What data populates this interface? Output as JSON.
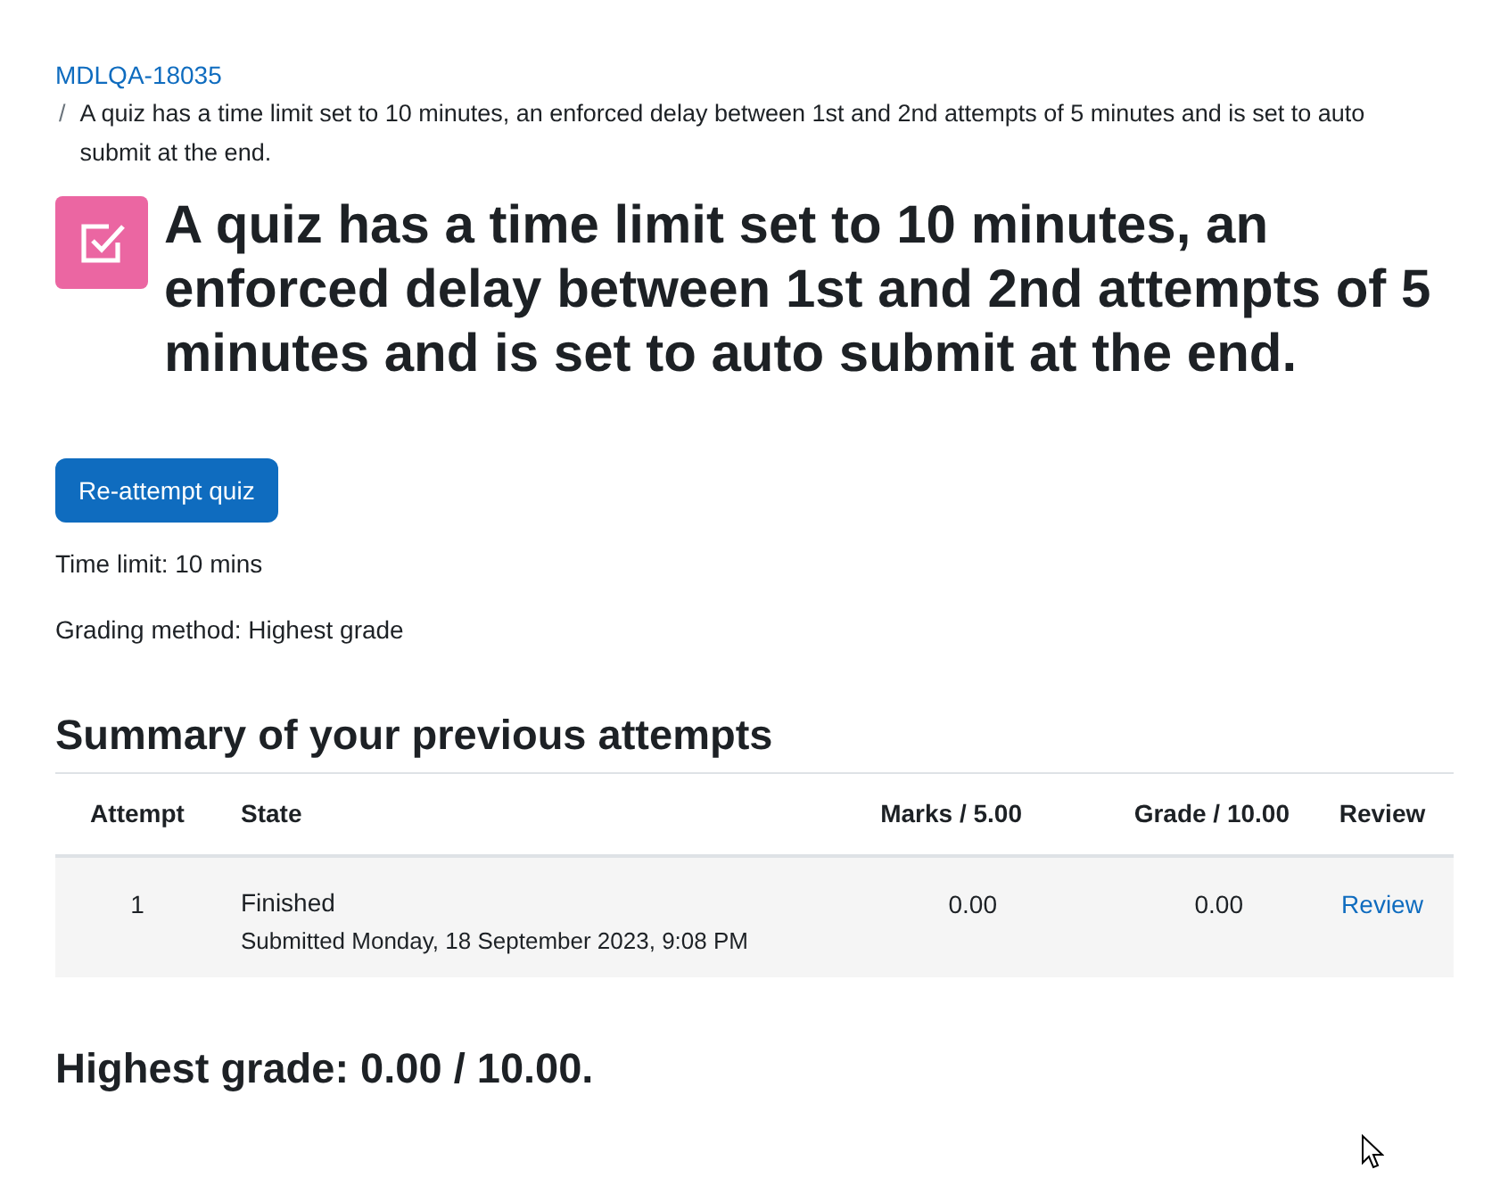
{
  "breadcrumb": [
    {
      "label": "MDLQA-18035",
      "kind": "link"
    },
    {
      "label": "/",
      "kind": "separator"
    },
    {
      "label": "A quiz has a time limit set to 10 minutes, an enforced delay between 1st and 2nd attempts of 5 minutes and is set to auto submit at the end.",
      "kind": "current"
    }
  ],
  "page_title": "A quiz has a time limit set to 10 minutes, an enforced delay between 1st and 2nd attempts of 5 minutes and is set to auto submit at the end.",
  "primary_button": "Re-attempt quiz",
  "info": [
    "Time limit: 10 mins",
    "Grading method: Highest grade"
  ],
  "summary": {
    "title": "Summary of your previous attempts",
    "columns": [
      "Attempt",
      "State",
      "Marks / 5.00",
      "Grade / 10.00",
      "Review"
    ],
    "rows": [
      {
        "attempt": "1",
        "state": "Finished",
        "submitted": "Submitted Monday, 18 September 2023, 9:08 PM",
        "marks": "0.00",
        "grade": "0.00",
        "review": "Review"
      }
    ]
  },
  "final_grade": "Highest grade: 0.00 / 10.00."
}
